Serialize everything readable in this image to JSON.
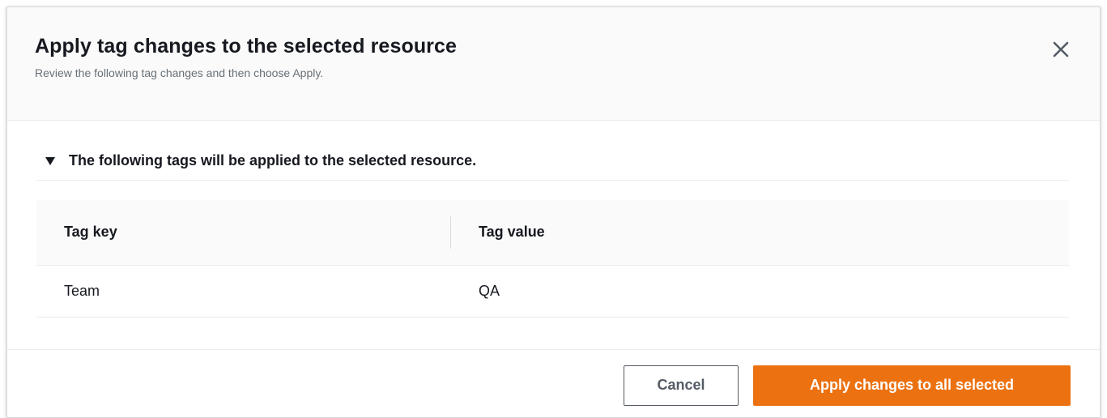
{
  "header": {
    "title": "Apply tag changes to the selected resource",
    "subtitle": "Review the following tag changes and then choose Apply."
  },
  "section": {
    "expander_label": "The following tags will be applied to the selected resource."
  },
  "table": {
    "columns": [
      "Tag key",
      "Tag value"
    ],
    "rows": [
      {
        "key": "Team",
        "value": "QA"
      }
    ]
  },
  "footer": {
    "cancel_label": "Cancel",
    "apply_label": "Apply changes to all selected"
  },
  "colors": {
    "primary": "#ec7211",
    "header_bg": "#fafafa",
    "text": "#16191f",
    "muted": "#687078"
  },
  "icons": {
    "close": "close-icon",
    "caret": "caret-down-icon"
  }
}
